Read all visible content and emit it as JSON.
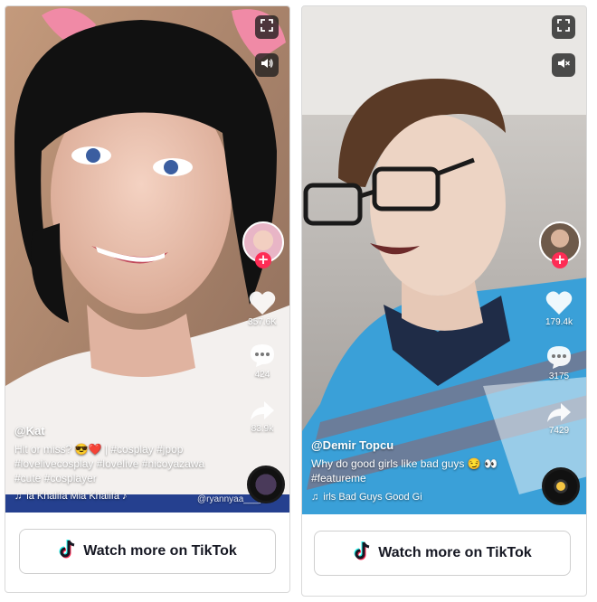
{
  "cards": [
    {
      "author": "@Kat",
      "description_text": "Hit or miss? 😎❤️ | ",
      "hashtags": [
        "#cosplay",
        "#jpop",
        "#lovelivecosplay",
        "#lovelive",
        "#nicoyazawa",
        "#cute",
        "#cosplayer"
      ],
      "music": "ia Khalifa   Mia Khalifa ♪",
      "likes": "357.6K",
      "comments": "424",
      "shares": "83.9k",
      "watermark": "@ryannyaa___y",
      "watch_label": "Watch more on TikTok",
      "volume_state": "on"
    },
    {
      "author": "@Demir Topcu",
      "description_text": "Why do good girls like bad guys 😏",
      "hashtags": [
        "👀",
        "#featureme"
      ],
      "music": "irls Bad Guys   Good Gi",
      "likes": "179.4k",
      "comments": "3175",
      "shares": "7429",
      "watch_label": "Watch more on TikTok",
      "volume_state": "muted"
    }
  ],
  "colors": {
    "brand_red": "#fe2c55",
    "brand_cyan": "#25f4ee",
    "text_dark": "#161823"
  },
  "icons": [
    "fullscreen-icon",
    "volume-icon",
    "mute-icon",
    "heart-icon",
    "comment-icon",
    "share-icon",
    "music-note-icon",
    "tiktok-logo-icon"
  ]
}
